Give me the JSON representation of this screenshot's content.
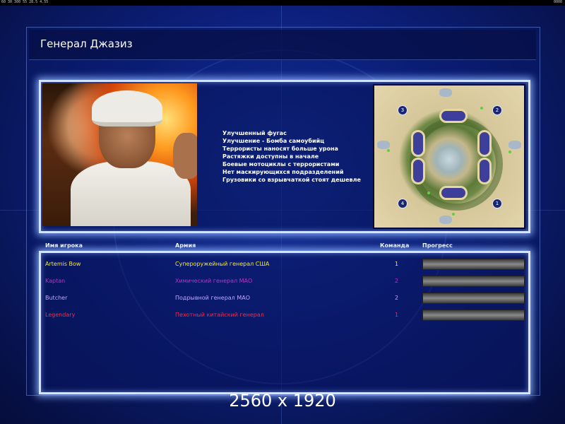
{
  "status_strip": {
    "left": "60 30 300 55 28.5 4.55",
    "right": "0000"
  },
  "screen": {
    "title": "Генерал Джазиз"
  },
  "briefing": {
    "portrait_icon": "general-portrait",
    "features": [
      "Улучшенный фугас",
      "Улучшение - Бомба самоубийц",
      "Террористы наносят больше урона",
      "Растяжки доступны в начале",
      "Боевые мотоциклы с террористами",
      "Нет маскирующихся подразделений",
      "Грузовики со взрывчаткой стоят дешевле"
    ],
    "map": {
      "icon": "minimap",
      "start_positions": [
        "1",
        "2",
        "3",
        "4"
      ]
    }
  },
  "table": {
    "headers": {
      "player": "Имя игрока",
      "army": "Армия",
      "team": "Команда",
      "progress": "Прогресс"
    },
    "rows": [
      {
        "name": "Artemis Bow",
        "army": "Супероружейный генерал США",
        "team": "1",
        "color": "#f2e640",
        "progress": 1.0
      },
      {
        "name": "Kaptan",
        "army": "Химический генерал МАО",
        "team": "2",
        "color": "#c030c8",
        "progress": 1.0
      },
      {
        "name": "Butcher",
        "army": "Подрывной генерал МАО",
        "team": "2",
        "color": "#c0a8ff",
        "progress": 1.0
      },
      {
        "name": "Legendary",
        "army": "Пехотный китайский генерал",
        "team": "1",
        "color": "#ff2a3a",
        "progress": 1.0
      }
    ]
  },
  "overlay": {
    "resolution": "2560 x 1920"
  }
}
